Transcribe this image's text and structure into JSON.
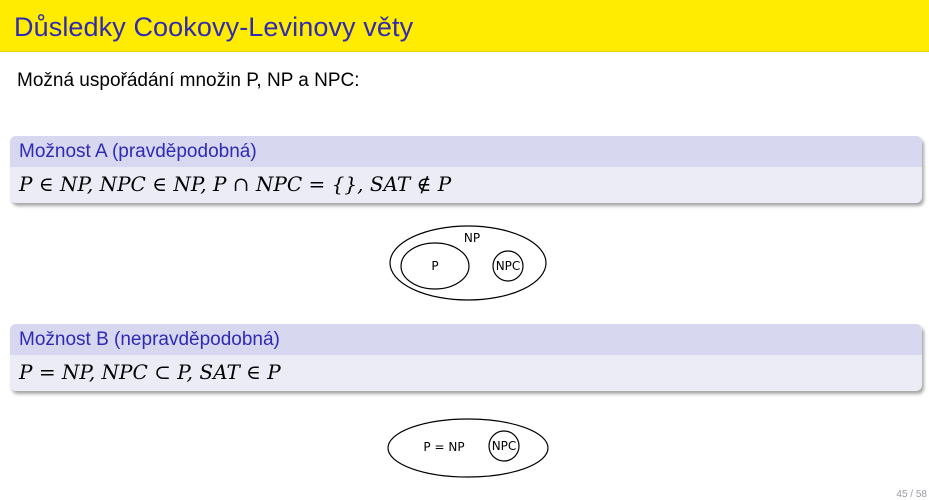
{
  "slide": {
    "title": "Důsledky Cookovy-Levinovy věty",
    "intro": "Možná uspořádání množin P, NP a NPC:",
    "page": "45 / 58"
  },
  "option_a": {
    "title": "Možnost A (pravděpodobná)",
    "formula": "P ∈ NP, NPC ∈ NP, P ∩ NPC = {}, SAT ∉ P",
    "diagram": {
      "outer_label": "NP",
      "left_label": "P",
      "right_label": "NPC"
    }
  },
  "option_b": {
    "title": "Možnost B (nepravděpodobná)",
    "formula": "P = NP, NPC ⊂ P, SAT ∈ P",
    "diagram": {
      "outer_label": "P = NP",
      "inner_label": "NPC"
    }
  },
  "colors": {
    "title_bar": "#ffec00",
    "title_text": "#2f2ab4",
    "block_header": "#d7d7ef",
    "block_body": "#ececf7"
  }
}
